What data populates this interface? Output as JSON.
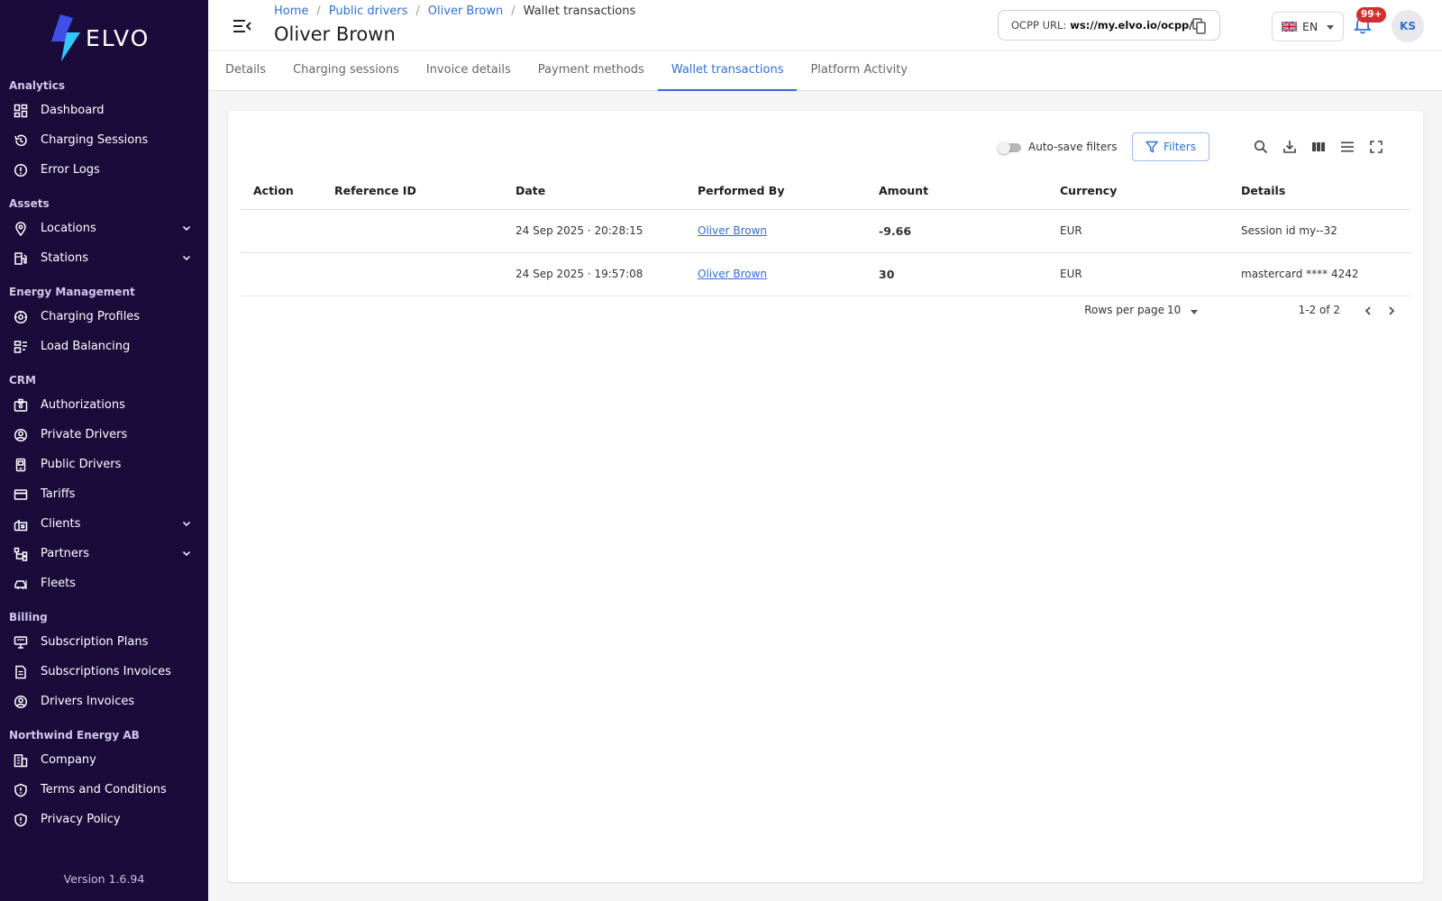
{
  "app": {
    "logo_text": "ELVO",
    "version": "Version 1.6.94"
  },
  "colors": {
    "sidebar": "#1a0b3b",
    "accent": "#2f6fd6",
    "negative": "#d32f2f",
    "positive": "#43a047"
  },
  "sidebar": {
    "sections": [
      {
        "title": "Analytics",
        "items": [
          {
            "label": "Dashboard",
            "icon": "dashboard-icon"
          },
          {
            "label": "Charging Sessions",
            "icon": "history-icon"
          },
          {
            "label": "Error Logs",
            "icon": "error-icon"
          }
        ]
      },
      {
        "title": "Assets",
        "items": [
          {
            "label": "Locations",
            "icon": "location-pin-icon",
            "expandable": true
          },
          {
            "label": "Stations",
            "icon": "station-icon",
            "expandable": true
          }
        ]
      },
      {
        "title": "Energy Management",
        "items": [
          {
            "label": "Charging Profiles",
            "icon": "speed-icon"
          },
          {
            "label": "Load Balancing",
            "icon": "balance-icon"
          }
        ]
      },
      {
        "title": "CRM",
        "items": [
          {
            "label": "Authorizations",
            "icon": "badge-icon"
          },
          {
            "label": "Private Drivers",
            "icon": "user-circle-icon"
          },
          {
            "label": "Public Drivers",
            "icon": "phone-icon"
          },
          {
            "label": "Tariffs",
            "icon": "card-icon"
          },
          {
            "label": "Clients",
            "icon": "building-icon",
            "expandable": true
          },
          {
            "label": "Partners",
            "icon": "hierarchy-icon",
            "expandable": true
          },
          {
            "label": "Fleets",
            "icon": "car-icon"
          }
        ]
      },
      {
        "title": "Billing",
        "items": [
          {
            "label": "Subscription Plans",
            "icon": "plan-icon"
          },
          {
            "label": "Subscriptions Invoices",
            "icon": "document-icon"
          },
          {
            "label": "Drivers Invoices",
            "icon": "user-circle-icon"
          }
        ]
      },
      {
        "title": "Northwind Energy AB",
        "items": [
          {
            "label": "Company",
            "icon": "company-icon"
          },
          {
            "label": "Terms and Conditions",
            "icon": "shield-icon"
          },
          {
            "label": "Privacy Policy",
            "icon": "shield-icon"
          }
        ]
      }
    ]
  },
  "header": {
    "breadcrumb": [
      "Home",
      "Public drivers",
      "Oliver Brown"
    ],
    "breadcrumb_current": "Wallet transactions",
    "title": "Oliver Brown",
    "ocpp_label": "OCPP URL:",
    "ocpp_url": "ws://my.elvo.io/ocpp/",
    "language": "EN",
    "notifications": "99+",
    "user_initials": "KS"
  },
  "tabs": [
    {
      "label": "Details",
      "active": false
    },
    {
      "label": "Charging sessions",
      "active": false
    },
    {
      "label": "Invoice details",
      "active": false
    },
    {
      "label": "Payment methods",
      "active": false
    },
    {
      "label": "Wallet transactions",
      "active": true
    },
    {
      "label": "Platform Activity",
      "active": false
    }
  ],
  "toolbar": {
    "autosave_label": "Auto-save filters",
    "autosave_on": false,
    "filters_label": "Filters"
  },
  "table": {
    "columns": [
      "Action",
      "Reference ID",
      "Date",
      "Performed By",
      "Amount",
      "Currency",
      "Details"
    ],
    "rows": [
      {
        "action": "",
        "reference_id": "",
        "date": "24 Sep 2025 · 20:28:15",
        "performed_by": "Oliver Brown",
        "amount": "-9.66",
        "amount_sign": "negative",
        "currency": "EUR",
        "details": "Session id my--32"
      },
      {
        "action": "",
        "reference_id": "",
        "date": "24 Sep 2025 · 19:57:08",
        "performed_by": "Oliver Brown",
        "amount": "30",
        "amount_sign": "positive",
        "currency": "EUR",
        "details": "mastercard **** 4242"
      }
    ]
  },
  "pagination": {
    "rows_per_page_label": "Rows per page",
    "rows_per_page": "10",
    "range": "1-2 of 2"
  }
}
